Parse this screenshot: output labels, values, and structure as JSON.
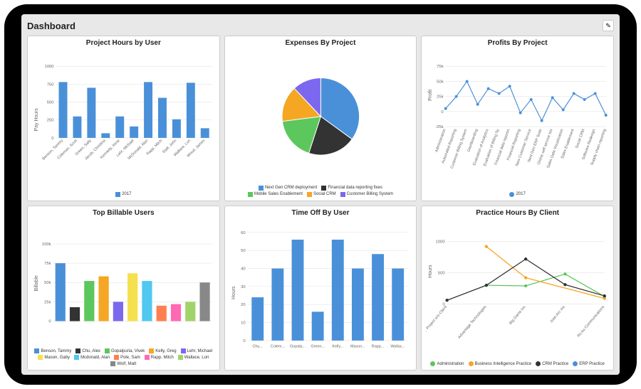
{
  "header": {
    "title": "Dashboard",
    "edit_icon": "✎"
  },
  "charts": [
    {
      "title": "Project Hours by User",
      "ylabel": "Pay Hours",
      "legend_label": "2017"
    },
    {
      "title": "Expenses By Project"
    },
    {
      "title": "Profits By Project",
      "ylabel": "Profit",
      "legend_label": "2017"
    },
    {
      "title": "Top Billable Users",
      "ylabel": "Billable"
    },
    {
      "title": "Time Off By User",
      "ylabel": "Hours"
    },
    {
      "title": "Practice Hours By Client",
      "ylabel": "Hours"
    }
  ],
  "chart_data": [
    {
      "type": "bar",
      "title": "Project Hours by User",
      "ylabel": "Pay Hours",
      "ylim": [
        0,
        1000
      ],
      "yticks": [
        0,
        250,
        500,
        750,
        1000
      ],
      "categories": [
        "Benson, Tammy",
        "Coleman, Scott",
        "Green, Sally",
        "Jacob, Christina",
        "Kennedy, Irene",
        "Lehr, Michael",
        "McDonald, Alan",
        "Rapp, Mitch",
        "Stall, John",
        "Wallace, Lori",
        "Wood, James"
      ],
      "series": [
        {
          "name": "2017",
          "color": "#4a90d9",
          "values": [
            780,
            300,
            700,
            65,
            300,
            160,
            780,
            560,
            260,
            770,
            135
          ]
        }
      ]
    },
    {
      "type": "pie",
      "title": "Expenses By Project",
      "slices": [
        {
          "name": "Next Gen CRM deployment",
          "value": 35,
          "color": "#4a90d9"
        },
        {
          "name": "Financial data reporting fixes",
          "value": 20,
          "color": "#333333"
        },
        {
          "name": "Mobile Sales Enablement",
          "value": 18,
          "color": "#5cc75c"
        },
        {
          "name": "Social CRM",
          "value": 15,
          "color": "#f5a623"
        },
        {
          "name": "Customer Billing System",
          "value": 12,
          "color": "#7b68ee"
        }
      ]
    },
    {
      "type": "line",
      "title": "Profits By Project",
      "ylabel": "Profit",
      "ylim": [
        -25000,
        75000
      ],
      "yticks": [
        -25000,
        0,
        25000,
        50000,
        75000
      ],
      "ytick_labels": [
        "-25k",
        "0",
        "25k",
        "50k",
        "75k"
      ],
      "categories": [
        "Administration",
        "Automated Reporting",
        "Customer Billing System",
        "Dashboarding",
        "Evaluation of Analytics",
        "Evaluation of Billing Sy",
        "Financial data reportin",
        "Financial Reporting",
        "New Customer Service",
        "Next Gen ERP Suite",
        "Online self service too",
        "Sales Data Visualization",
        "Sales Enablement",
        "Social CRM",
        "Software Redesign",
        "Supply chain reporting"
      ],
      "series": [
        {
          "name": "2017",
          "color": "#4a90d9",
          "values": [
            5000,
            25000,
            50000,
            12000,
            38000,
            30000,
            42000,
            -2000,
            20000,
            -15000,
            23000,
            3000,
            30000,
            20000,
            30000,
            -6000
          ]
        }
      ]
    },
    {
      "type": "bar",
      "title": "Top Billable Users",
      "ylabel": "Billable",
      "ylim": [
        0,
        100000
      ],
      "yticks": [
        0,
        25000,
        50000,
        75000,
        100000
      ],
      "ytick_labels": [
        "0",
        "25k",
        "50k",
        "75k",
        "100k"
      ],
      "categories": [
        "Benson, Tammy",
        "Chu, Alex",
        "Gopalpuria, Vivek",
        "Kelly, Greg",
        "Lehr, Michael",
        "Mason, Gaby",
        "Mcdonald, Alan",
        "Pole, Sam",
        "Rapp, Mitch",
        "Wallace, Lori",
        "Wolf, Matt"
      ],
      "colors": [
        "#4a90d9",
        "#333333",
        "#5cc75c",
        "#f5a623",
        "#7b68ee",
        "#f5e050",
        "#50c8f0",
        "#ff7f50",
        "#ff69b4",
        "#a0d468",
        "#888888"
      ],
      "values": [
        75000,
        18000,
        52000,
        58000,
        25000,
        62000,
        52000,
        20000,
        22000,
        25000,
        50000
      ]
    },
    {
      "type": "bar",
      "title": "Time Off By User",
      "ylabel": "Hours",
      "ylim": [
        0,
        60
      ],
      "yticks": [
        0,
        10,
        20,
        30,
        40,
        50,
        60
      ],
      "categories": [
        "Chu...",
        "Colem...",
        "Gopalp...",
        "Green...",
        "Kelly...",
        "Mason...",
        "Rapp...",
        "Wallac..."
      ],
      "series": [
        {
          "name": "Hours",
          "color": "#4a90d9",
          "values": [
            24,
            40,
            56,
            16,
            56,
            40,
            48,
            40
          ]
        }
      ]
    },
    {
      "type": "line",
      "title": "Practice Hours By Client",
      "ylabel": "Hours",
      "ylim": [
        0,
        1000
      ],
      "yticks": [
        0,
        500,
        1000
      ],
      "categories": [
        "No Client: Project w/o Client",
        "Advantage Technologies",
        "Big Game Inc",
        "Joan Arc Inc",
        "Ro ku Communications"
      ],
      "series": [
        {
          "name": "Administration",
          "color": "#5cc75c",
          "values": [
            null,
            300,
            290,
            480,
            120
          ]
        },
        {
          "name": "Business Intelligence Practice",
          "color": "#f5a623",
          "values": [
            null,
            920,
            420,
            null,
            90
          ]
        },
        {
          "name": "CRM Practice",
          "color": "#333333",
          "values": [
            60,
            300,
            720,
            310,
            130
          ]
        },
        {
          "name": "ERP Practice",
          "color": "#4a90d9",
          "values": [
            null,
            null,
            null,
            null,
            null
          ]
        }
      ]
    }
  ]
}
